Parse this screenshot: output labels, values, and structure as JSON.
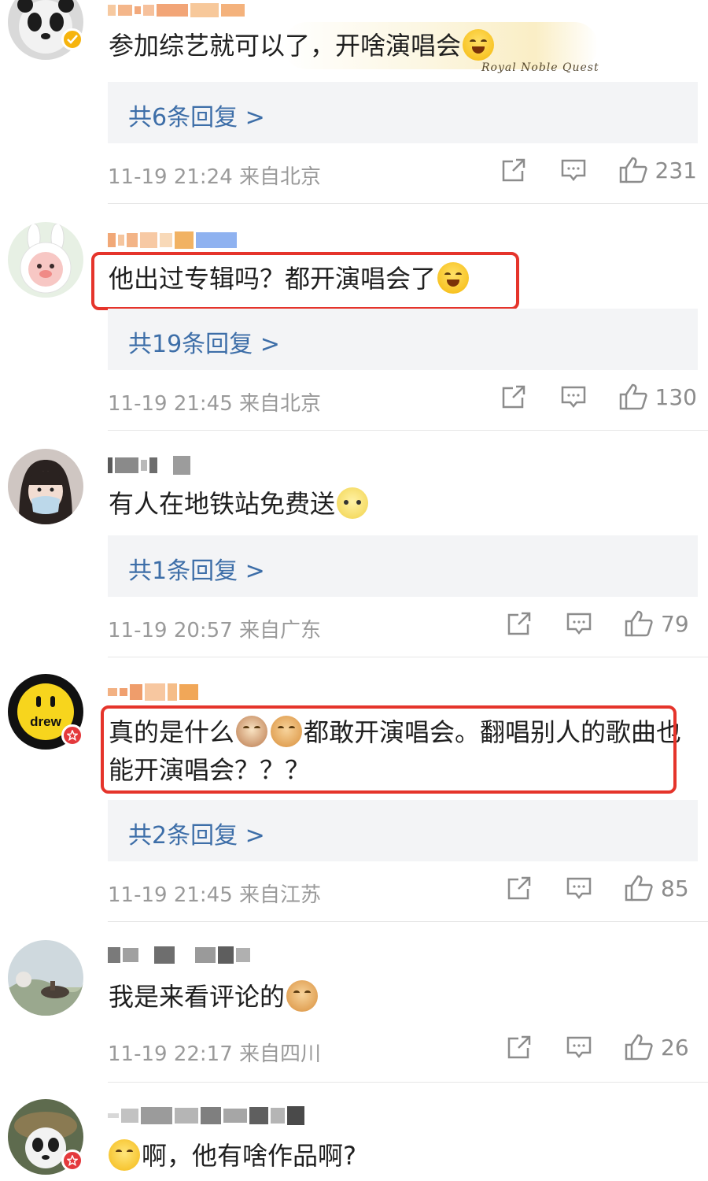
{
  "comments": [
    {
      "text": "参加综艺就可以了，开啥演唱会",
      "replies": "共6条回复 >",
      "meta": "11-19 21:24  来自北京",
      "likes": "231",
      "watermark": "Royal Noble Quest",
      "emoji": "laughing-crying-emoji"
    },
    {
      "text": "他出过专辑吗？都开演唱会了",
      "replies": "共19条回复 >",
      "meta": "11-19 21:45  来自北京",
      "likes": "130",
      "emoji": "laughing-crying-emoji"
    },
    {
      "text": "有人在地铁站免费送",
      "replies": "共1条回复 >",
      "meta": "11-19 20:57  来自广东",
      "likes": "79",
      "emoji": "pear-face-emoji"
    },
    {
      "text_a": "真的是什么",
      "text_b": "都敢开演唱会。翻唱别人的歌曲也能开演唱会？？？",
      "replies": "共2条回复 >",
      "meta": "11-19 21:45  来自江苏",
      "likes": "85",
      "avatar_text": "drew",
      "emoji": "cat-emoji, doge-emoji"
    },
    {
      "text": "我是来看评论的",
      "meta": "11-19 22:17  来自四川",
      "likes": "26",
      "emoji": "doge-emoji"
    },
    {
      "text": "啊，他有啥作品啊?",
      "emoji": "thinking-emoji"
    }
  ],
  "colors": {
    "highlight": "#e5342b",
    "reply_link": "#3d6ea8",
    "reply_bg": "#f3f4f6",
    "meta": "#9a9a9a"
  },
  "icons": [
    "share-icon",
    "comment-icon",
    "thumbs-up-icon",
    "verified-badge-icon",
    "vip-badge-icon"
  ]
}
